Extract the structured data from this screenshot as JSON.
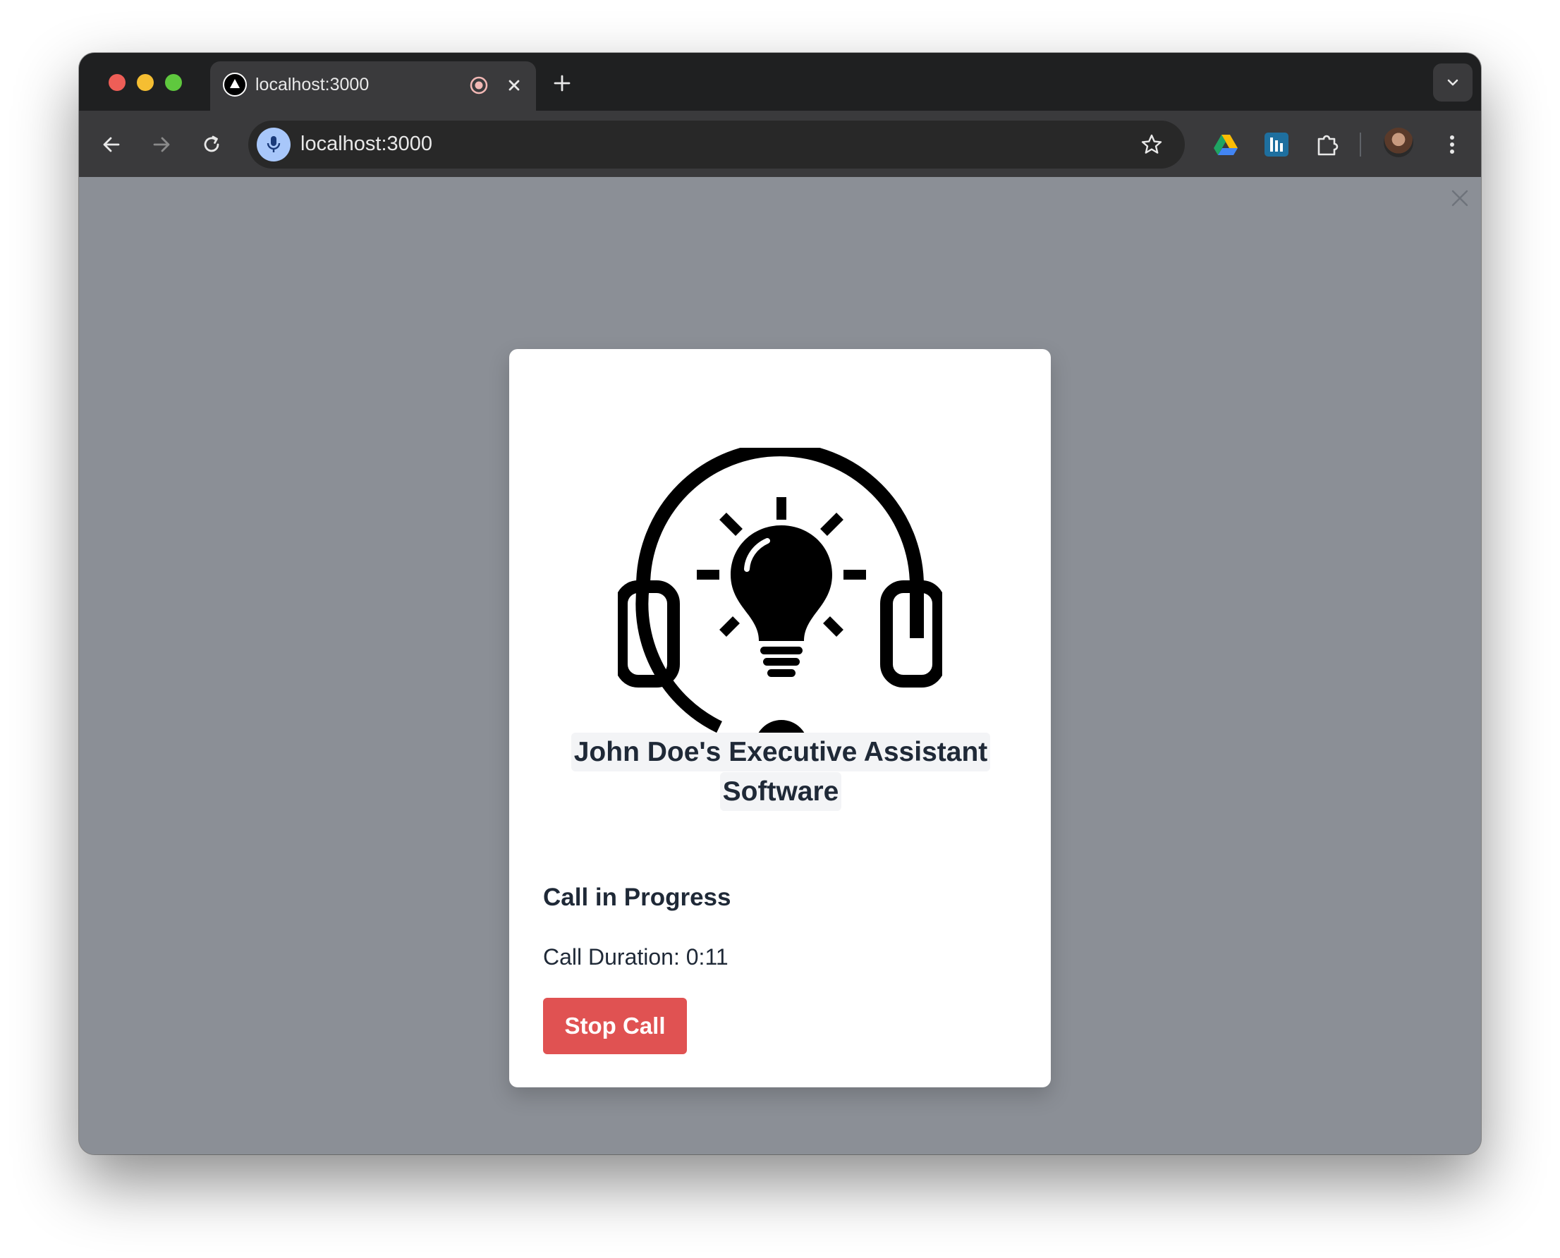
{
  "browser": {
    "tab": {
      "title": "localhost:3000",
      "favicon": "nextjs-triangle-icon",
      "recording_icon": "record-icon",
      "close_icon": "close-icon"
    },
    "new_tab_icon": "plus-icon",
    "tab_search_icon": "chevron-down-icon",
    "toolbar": {
      "back_icon": "arrow-left-icon",
      "forward_icon": "arrow-right-icon",
      "reload_icon": "reload-icon",
      "mic_icon": "microphone-icon",
      "url": "localhost:3000",
      "bookmark_icon": "star-icon",
      "extensions": [
        "google-drive-icon",
        "extension-app-icon",
        "puzzle-piece-icon"
      ],
      "profile": "avatar",
      "menu_icon": "kebab-menu-icon"
    },
    "colors": {
      "titlebar": "#1f2021",
      "toolbar": "#3a3a3c",
      "omnibox": "#282828",
      "mic_badge": "#a8c7fa"
    }
  },
  "page": {
    "background": "#8b8f96",
    "overlay_close_icon": "close-icon",
    "modal": {
      "logo_icon": "headset-lightbulb-icon",
      "title": "John Doe's Executive Assistant Software",
      "status_heading": "Call in Progress",
      "duration_label": "Call Duration:",
      "duration_value": "0:11",
      "stop_button_label": "Stop Call",
      "stop_button_color": "#e05252",
      "text_color": "#1f2937",
      "title_highlight": "#f3f4f6"
    }
  }
}
